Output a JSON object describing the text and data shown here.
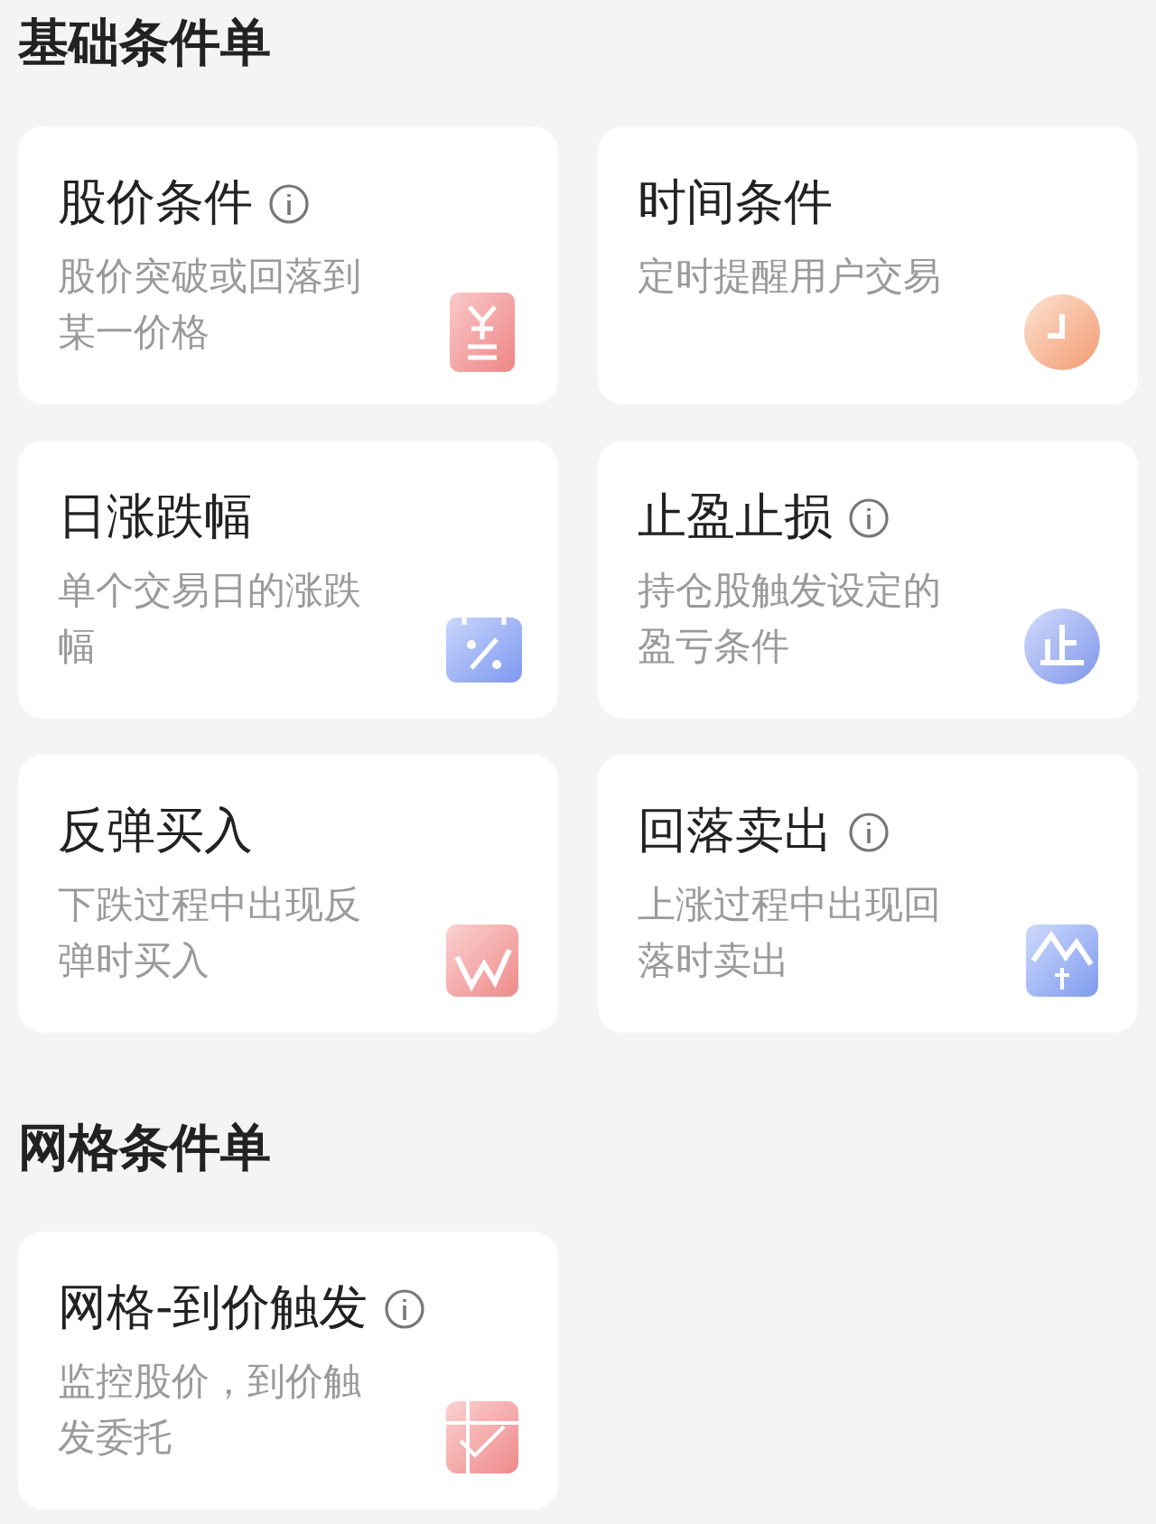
{
  "sections": [
    {
      "title": "基础条件单",
      "cards": [
        {
          "title": "股价条件",
          "info": true,
          "description": "股价突破或回落到某一价格",
          "kind": "price"
        },
        {
          "title": "时间条件",
          "info": false,
          "description": "定时提醒用户交易",
          "kind": "clock"
        },
        {
          "title": "日涨跌幅",
          "info": false,
          "description": "单个交易日的涨跌幅",
          "kind": "calendar"
        },
        {
          "title": "止盈止损",
          "info": true,
          "description": "持仓股触发设定的盈亏条件",
          "kind": "stop"
        },
        {
          "title": "反弹买入",
          "info": false,
          "description": "下跌过程中出现反弹时买入",
          "kind": "rebound"
        },
        {
          "title": "回落卖出",
          "info": true,
          "description": "上涨过程中出现回落时卖出",
          "kind": "fall"
        }
      ]
    },
    {
      "title": "网格条件单",
      "cards": [
        {
          "title": "网格-到价触发",
          "info": true,
          "description": "监控股价，到价触发委托",
          "kind": "grid"
        }
      ]
    }
  ]
}
